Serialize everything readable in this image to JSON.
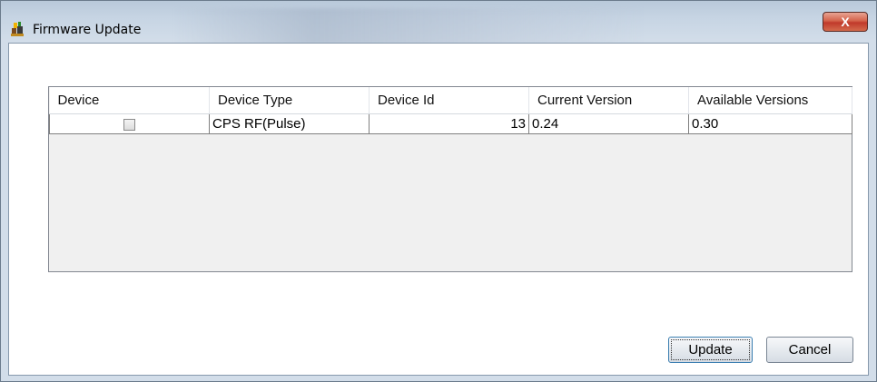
{
  "window": {
    "title": "Firmware Update",
    "close_label": "X"
  },
  "table": {
    "columns": [
      "Device",
      "Device Type",
      "Device Id",
      "Current Version",
      "Available Versions"
    ],
    "rows": [
      {
        "device_checked": false,
        "device_type": "CPS RF(Pulse)",
        "device_id": "13",
        "current_version": "0.24",
        "available_versions": "0.30"
      }
    ]
  },
  "buttons": {
    "update_label": "Update",
    "cancel_label": "Cancel"
  },
  "icons": {
    "app": "firmware-app-icon",
    "close": "close-icon"
  }
}
